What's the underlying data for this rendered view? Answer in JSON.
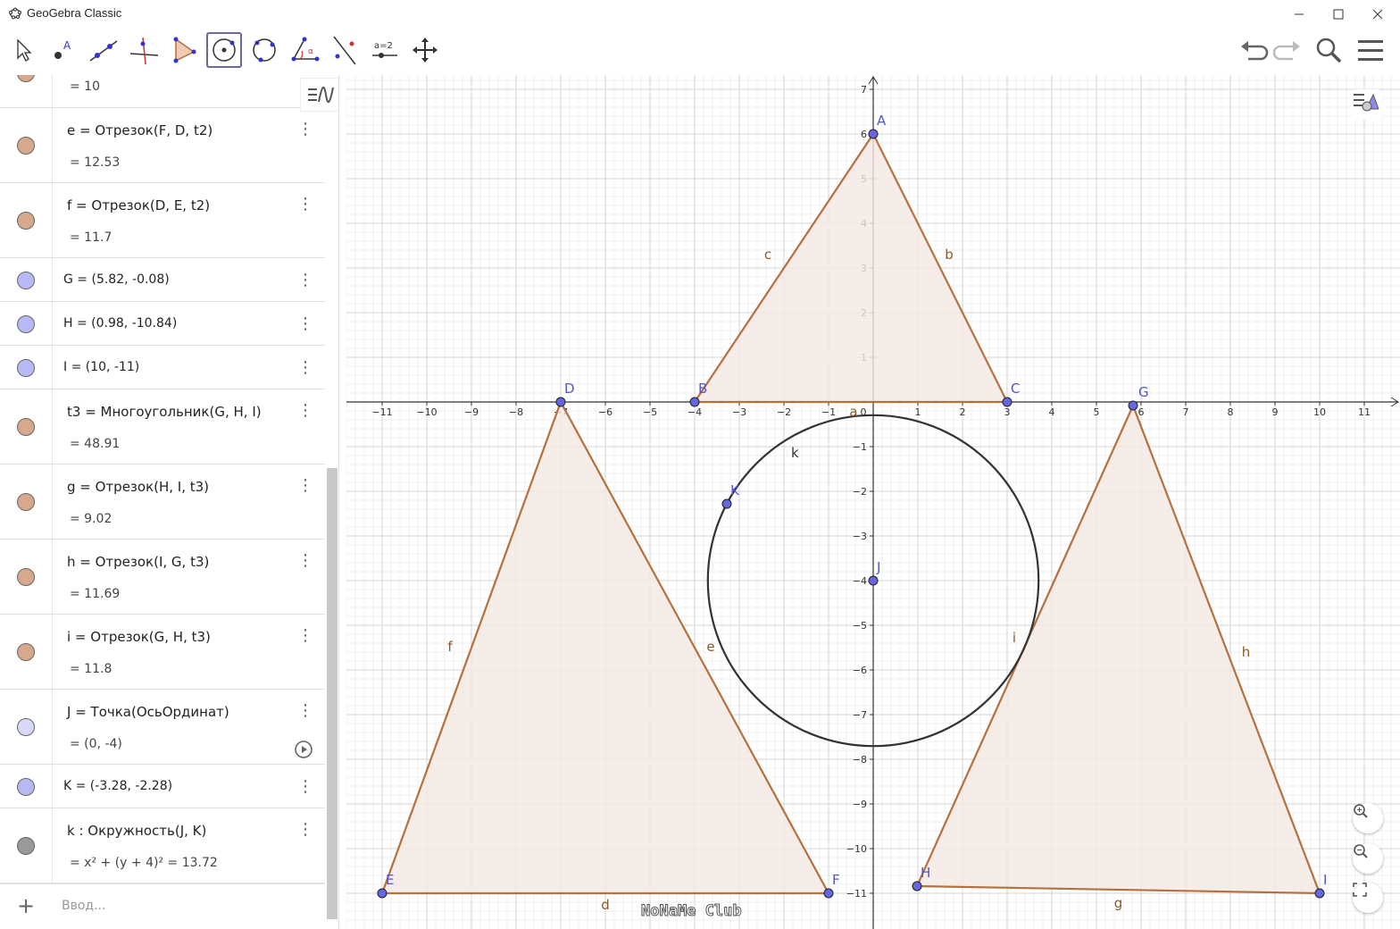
{
  "window": {
    "title": "GeoGebra Classic"
  },
  "toolbar": {
    "tools": [
      "move-tool",
      "point-tool",
      "line-tool",
      "perpendicular-tool",
      "polygon-tool",
      "circle-center-point-tool",
      "circle-three-points-tool",
      "angle-tool",
      "reflect-tool",
      "slider-tool",
      "move-view-tool"
    ],
    "active": "circle-center-point-tool",
    "slider_label": "a=2"
  },
  "algebra": {
    "rows": [
      {
        "def": "",
        "val": "=  10",
        "color": "#d6a88c",
        "h": 37,
        "partial": true
      },
      {
        "def": "e  =  Отрезок(F, D, t2)",
        "val": "=  12.53",
        "color": "#d6a88c",
        "h": 84
      },
      {
        "def": "f  =  Отрезок(D, E, t2)",
        "val": "=  11.7",
        "color": "#d6a88c",
        "h": 84
      },
      {
        "def": "G = (5.82, -0.08)",
        "val": "",
        "color": "#b8b8f5",
        "h": 49
      },
      {
        "def": "H = (0.98, -10.84)",
        "val": "",
        "color": "#b8b8f5",
        "h": 49
      },
      {
        "def": "I = (10, -11)",
        "val": "",
        "color": "#b8b8f5",
        "h": 49
      },
      {
        "def": "t3  =  Многоугольник(G, H, I)",
        "val": "=  48.91",
        "color": "#d6a88c",
        "h": 84
      },
      {
        "def": "g  =  Отрезок(H, I, t3)",
        "val": "=  9.02",
        "color": "#d6a88c",
        "h": 84
      },
      {
        "def": "h  =  Отрезок(I, G, t3)",
        "val": "=  11.69",
        "color": "#d6a88c",
        "h": 84
      },
      {
        "def": "i  =  Отрезок(G, H, t3)",
        "val": "=  11.8",
        "color": "#d6a88c",
        "h": 84
      },
      {
        "def": "J  =  Точка(ОсьОрдинат)",
        "val": "=  (0, -4)",
        "color": "#d8d8f8",
        "h": 84,
        "play": true
      },
      {
        "def": "K = (-3.28, -2.28)",
        "val": "",
        "color": "#b8b8f5",
        "h": 49
      },
      {
        "def": "k : Окружность(J, K)",
        "val": "=  x² + (y + 4)² = 13.72",
        "color": "#999999",
        "h": 84
      }
    ],
    "input_placeholder": "Ввод..."
  },
  "graphics": {
    "points": [
      {
        "name": "A",
        "x": 0,
        "y": 6
      },
      {
        "name": "B",
        "x": -4,
        "y": 0
      },
      {
        "name": "C",
        "x": 3,
        "y": 0
      },
      {
        "name": "D",
        "x": -7,
        "y": 0
      },
      {
        "name": "E",
        "x": -11,
        "y": -11
      },
      {
        "name": "F",
        "x": -1,
        "y": -11
      },
      {
        "name": "G",
        "x": 5.82,
        "y": -0.08
      },
      {
        "name": "H",
        "x": 0.98,
        "y": -10.84
      },
      {
        "name": "I",
        "x": 10,
        "y": -11
      },
      {
        "name": "J",
        "x": 0,
        "y": -4
      },
      {
        "name": "K",
        "x": -3.28,
        "y": -2.28
      }
    ],
    "polygons": [
      [
        "A",
        "B",
        "C"
      ],
      [
        "D",
        "E",
        "F"
      ],
      [
        "G",
        "H",
        "I"
      ]
    ],
    "segment_labels": [
      {
        "name": "a",
        "between": [
          "B",
          "C"
        ]
      },
      {
        "name": "b",
        "between": [
          "A",
          "C"
        ]
      },
      {
        "name": "c",
        "between": [
          "A",
          "B"
        ]
      },
      {
        "name": "d",
        "between": [
          "E",
          "F"
        ]
      },
      {
        "name": "e",
        "between": [
          "F",
          "D"
        ]
      },
      {
        "name": "f",
        "between": [
          "D",
          "E"
        ]
      },
      {
        "name": "g",
        "between": [
          "H",
          "I"
        ]
      },
      {
        "name": "h",
        "between": [
          "I",
          "G"
        ]
      },
      {
        "name": "i",
        "between": [
          "G",
          "H"
        ]
      }
    ],
    "circle": {
      "name": "k",
      "center": "J",
      "r2": 13.72
    },
    "x_ticks": [
      -11,
      -10,
      -9,
      -8,
      -7,
      -6,
      -5,
      -4,
      -3,
      -2,
      -1,
      0,
      1,
      2,
      3,
      4,
      5,
      6,
      7,
      8,
      9,
      10,
      11
    ],
    "y_ticks": [
      -11,
      -10,
      -9,
      -8,
      -7,
      -6,
      -5,
      -4,
      -3,
      -2,
      -1,
      1,
      2,
      3,
      4,
      5,
      6,
      7
    ],
    "colors": {
      "poly_fill": "#f4e8e2",
      "poly_stroke": "#b5703f",
      "point": "#6666e0",
      "circle": "#333333",
      "label_pt": "#5555cc"
    },
    "watermark": "NoNaMe Club"
  }
}
